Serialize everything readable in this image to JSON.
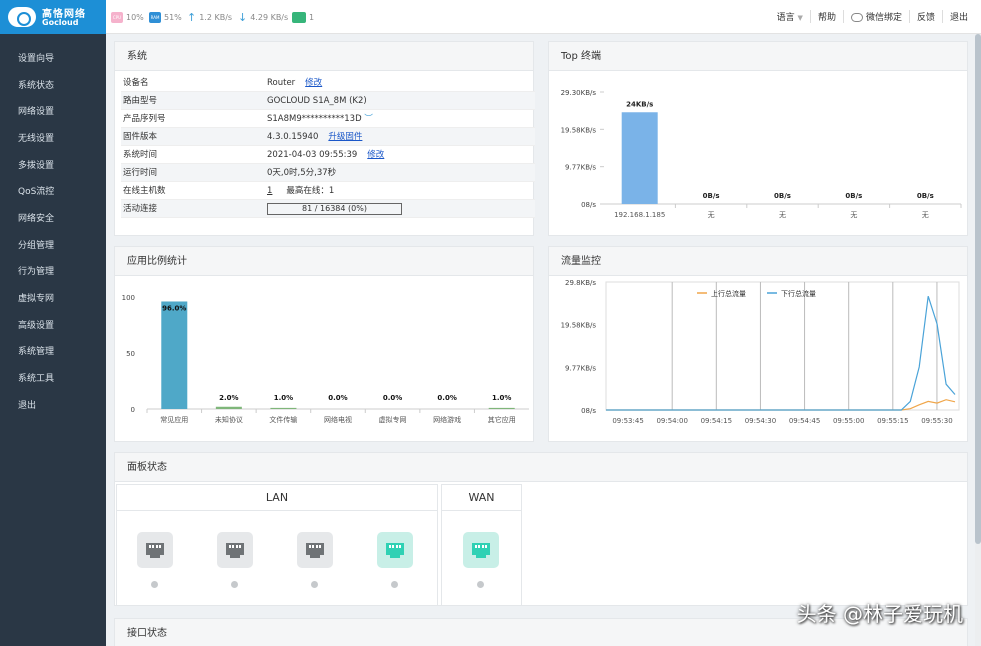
{
  "brand": {
    "name_cn": "高恪网络",
    "name_en": "Gocloud"
  },
  "status_bar": {
    "cpu_icon": "CPU",
    "cpu": "10%",
    "ram_icon": "RAM",
    "ram": "51%",
    "upload": "1.2 KB/s",
    "download": "4.29 KB/s",
    "terminals": "1"
  },
  "topnav": {
    "language": "语言",
    "help": "帮助",
    "wechat": "微信绑定",
    "feedback": "反馈",
    "logout": "退出"
  },
  "sidebar": {
    "items": [
      "设置向导",
      "系统状态",
      "网络设置",
      "无线设置",
      "多拨设置",
      "QoS流控",
      "网络安全",
      "分组管理",
      "行为管理",
      "虚拟专网",
      "高级设置",
      "系统管理",
      "系统工具",
      "退出"
    ]
  },
  "system": {
    "title": "系统",
    "rows": [
      {
        "key": "设备名",
        "value": "Router",
        "link": "修改"
      },
      {
        "key": "路由型号",
        "value": "GOCLOUD S1A_8M (K2)"
      },
      {
        "key": "产品序列号",
        "value": "S1A8M9**********13D"
      },
      {
        "key": "固件版本",
        "value": "4.3.0.15940",
        "link": "升级固件"
      },
      {
        "key": "系统时间",
        "value": "2021-04-03 09:55:39",
        "link": "修改"
      },
      {
        "key": "运行时间",
        "value": "0天,0时,5分,37秒"
      },
      {
        "key": "在线主机数",
        "value": "1",
        "extra": "最高在线：1"
      },
      {
        "key": "活动连接",
        "value": "81 / 16384 (0%)"
      }
    ]
  },
  "top_terminals": {
    "title": "Top 终端",
    "chart_data": {
      "type": "bar",
      "categories": [
        "192.168.1.185",
        "无",
        "无",
        "无",
        "无"
      ],
      "values": [
        24,
        0,
        0,
        0,
        0
      ],
      "value_labels": [
        "24KB/s",
        "0B/s",
        "0B/s",
        "0B/s",
        "0B/s"
      ],
      "yticks": [
        "08/s",
        "9.77KB/s",
        "19.58KB/s",
        "29.30KB/s"
      ],
      "ylim": [
        0,
        29.3
      ],
      "color": "#7ab3e8"
    }
  },
  "app_stats": {
    "title": "应用比例统计",
    "chart_data": {
      "type": "bar",
      "categories": [
        "常见应用",
        "未知协议",
        "文件传输",
        "网络电视",
        "虚拟专网",
        "网络游戏",
        "其它应用"
      ],
      "values": [
        96.0,
        2.0,
        1.0,
        0.0,
        0.0,
        0.0,
        1.0
      ],
      "value_labels": [
        "96.0%",
        "2.0%",
        "1.0%",
        "0.0%",
        "0.0%",
        "0.0%",
        "1.0%"
      ],
      "yticks": [
        "0",
        "50",
        "100"
      ],
      "ylim": [
        0,
        100
      ],
      "color": "#4fa8c8"
    }
  },
  "traffic": {
    "title": "流量监控",
    "chart_data": {
      "type": "line",
      "x": [
        "09:53:45",
        "09:54:00",
        "09:54:15",
        "09:54:30",
        "09:54:45",
        "09:55:00",
        "09:55:15",
        "09:55:30"
      ],
      "yticks": [
        "08/s",
        "9.77KB/s",
        "19.58KB/s",
        "29.8KB/s"
      ],
      "ylim": [
        0,
        29.8
      ],
      "series": [
        {
          "name": "上行总流量",
          "color": "#f0a64a",
          "values": [
            0,
            0,
            0,
            0,
            0,
            0,
            0,
            0,
            0,
            0,
            0,
            0,
            0,
            0,
            0,
            0,
            0,
            0,
            0,
            0,
            0,
            0,
            0,
            0,
            0,
            0,
            0,
            0,
            0,
            0,
            0,
            0,
            0,
            0,
            0.3,
            1.2,
            2.0,
            1.6,
            2.4,
            1.9
          ]
        },
        {
          "name": "下行总流量",
          "color": "#4aa3d8",
          "values": [
            0,
            0,
            0,
            0,
            0,
            0,
            0,
            0,
            0,
            0,
            0,
            0,
            0,
            0,
            0,
            0,
            0,
            0,
            0,
            0,
            0,
            0,
            0,
            0,
            0,
            0,
            0,
            0,
            0,
            0,
            0,
            0,
            0,
            0,
            2.0,
            10.0,
            26.5,
            20.0,
            6.0,
            3.6
          ]
        }
      ]
    }
  },
  "panel_status": {
    "title": "面板状态",
    "lan_label": "LAN",
    "wan_label": "WAN",
    "ports": [
      {
        "group": "lan",
        "state": "down"
      },
      {
        "group": "lan",
        "state": "down"
      },
      {
        "group": "lan",
        "state": "down"
      },
      {
        "group": "lan",
        "state": "up"
      },
      {
        "group": "wan",
        "state": "up"
      }
    ]
  },
  "interface_status": {
    "title": "接口状态"
  },
  "watermark": "头条 @林子爱玩机"
}
